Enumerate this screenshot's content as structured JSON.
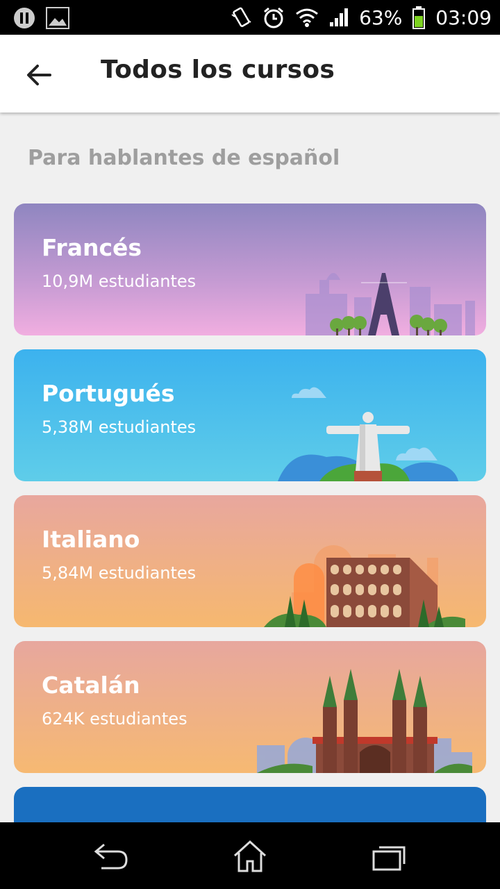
{
  "status_bar": {
    "battery": "63%",
    "time": "03:09"
  },
  "header": {
    "title": "Todos los cursos"
  },
  "section": {
    "heading": "Para hablantes de español"
  },
  "courses": [
    {
      "name": "Francés",
      "students": "10,9M estudiantes"
    },
    {
      "name": "Portugués",
      "students": "5,38M estudiantes"
    },
    {
      "name": "Italiano",
      "students": "5,84M estudiantes"
    },
    {
      "name": "Catalán",
      "students": "624K estudiantes"
    }
  ],
  "colors": {
    "frances": "#b98fcf",
    "portugues": "#3cb2ee",
    "italiano": "#f0ad86",
    "catalan": "#efae88",
    "next_card": "#1a6fc0"
  },
  "icons": [
    "pause-icon",
    "image-icon",
    "vibrate-icon",
    "alarm-icon",
    "wifi-icon",
    "signal-icon",
    "battery-icon",
    "back-arrow-icon",
    "nav-back-icon",
    "nav-home-icon",
    "nav-recents-icon"
  ]
}
